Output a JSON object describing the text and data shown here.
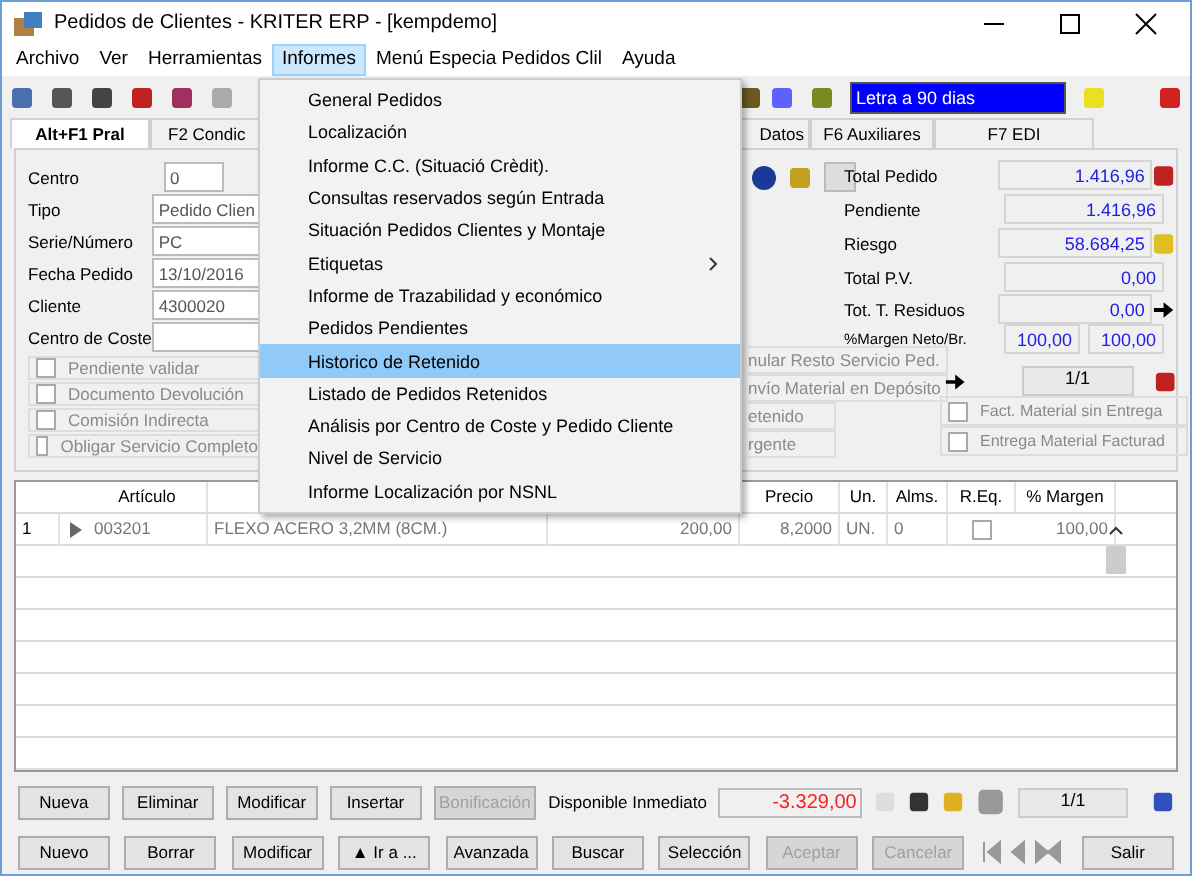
{
  "window": {
    "title": "Pedidos de Clientes - KRITER ERP - [kempdemo]"
  },
  "menu_bar": [
    {
      "label": "Archivo",
      "selected": false
    },
    {
      "label": "Ver",
      "selected": false
    },
    {
      "label": "Herramientas",
      "selected": false
    },
    {
      "label": "Informes",
      "selected": true
    },
    {
      "label": "Menú Especia Pedidos Clil",
      "selected": false
    },
    {
      "label": "Ayuda",
      "selected": false
    }
  ],
  "dropdown": [
    {
      "label": "General Pedidos",
      "selected": false,
      "submenu": false
    },
    {
      "label": "Localización",
      "selected": false,
      "submenu": false
    },
    {
      "label": "Informe C.C. (Situació Crèdit).",
      "selected": false,
      "submenu": false
    },
    {
      "label": "Consultas reservados según Entrada",
      "selected": false,
      "submenu": false
    },
    {
      "label": "Situación Pedidos Clientes y Montaje",
      "selected": false,
      "submenu": false
    },
    {
      "label": "Etiquetas",
      "selected": false,
      "submenu": true
    },
    {
      "label": "Informe de Trazabilidad y económico",
      "selected": false,
      "submenu": false
    },
    {
      "label": "Pedidos Pendientes",
      "selected": false,
      "submenu": false
    },
    {
      "label": "Historico de Retenido",
      "selected": true,
      "submenu": false
    },
    {
      "label": "Listado de Pedidos Retenidos",
      "selected": false,
      "submenu": false
    },
    {
      "label": "Análisis por Centro de Coste y Pedido Cliente",
      "selected": false,
      "submenu": false
    },
    {
      "label": "Nivel de Servicio",
      "selected": false,
      "submenu": false
    },
    {
      "label": "Informe Localización por NSNL",
      "selected": false,
      "submenu": false
    }
  ],
  "payment_field": "Letra a 90 dias",
  "tabs": [
    {
      "label": "Alt+F1 Pral",
      "selected": true
    },
    {
      "label": "F2 Condic",
      "selected": false
    },
    {
      "label": "Datos",
      "selected": false
    },
    {
      "label": "F6 Auxiliares",
      "selected": false
    },
    {
      "label": "F7 EDI",
      "selected": false
    }
  ],
  "form": [
    {
      "label": "Centro",
      "value": "0"
    },
    {
      "label": "Tipo",
      "value": "Pedido Clien"
    },
    {
      "label": "Serie/Número",
      "value": "PC"
    },
    {
      "label": "Fecha Pedido",
      "value": "13/10/2016"
    },
    {
      "label": "Cliente",
      "value": "4300020"
    },
    {
      "label": "Centro de Coste"
    }
  ],
  "left_checks": [
    {
      "label": "Pendiente validar",
      "checked": false
    },
    {
      "label": "Documento Devolución",
      "checked": false
    },
    {
      "label": "Comisión Indirecta",
      "checked": false
    },
    {
      "label": "Obligar Servicio Completo",
      "checked": false
    }
  ],
  "middle_items": [
    "nular Resto Servicio Ped.",
    "nvío Material en Depósito",
    "etenido",
    "rgente"
  ],
  "totals": [
    {
      "label": "Total Pedido",
      "value": "1.416,96"
    },
    {
      "label": "Pendiente",
      "value": "1.416,96"
    },
    {
      "label": "Riesgo",
      "value": "58.684,25"
    },
    {
      "label": "Total P.V.",
      "value": "0,00"
    },
    {
      "label": "Tot. T. Residuos",
      "value": "0,00"
    }
  ],
  "margin": {
    "label": "%Margen Neto/Br.",
    "neto": "100,00",
    "bruto": "100,00"
  },
  "pager_top": "1/1",
  "right_checks": [
    {
      "label": "Fact. Material sin Entrega",
      "checked": false
    },
    {
      "label": "Entrega Material Facturad",
      "checked": false
    }
  ],
  "table": {
    "columns": [
      "Artículo",
      "Precio",
      "Un.",
      "Alms.",
      "R.Eq.",
      "% Margen"
    ],
    "rows": [
      {
        "index": "1",
        "articulo": "003201",
        "descripcion": "FLEXO ACERO 3,2MM (8CM.)",
        "cantidad": "200,00",
        "precio": "8,2000",
        "un": "UN.",
        "alms": "0",
        "req": false,
        "margen": "100,00"
      }
    ]
  },
  "line_buttons": [
    {
      "label": "Nueva",
      "disabled": false
    },
    {
      "label": "Eliminar",
      "disabled": false
    },
    {
      "label": "Modificar",
      "disabled": false
    },
    {
      "label": "Insertar",
      "disabled": false
    },
    {
      "label": "Bonificación",
      "disabled": true
    }
  ],
  "disponible": {
    "label": "Disponible Inmediato",
    "value": "-3.329,00"
  },
  "pager_bottom": "1/1",
  "main_buttons": [
    {
      "label": "Nuevo",
      "disabled": false
    },
    {
      "label": "Borrar",
      "disabled": false
    },
    {
      "label": "Modificar",
      "disabled": false
    },
    {
      "label": "▲ Ir a ...",
      "disabled": false
    },
    {
      "label": "Avanzada",
      "disabled": false
    },
    {
      "label": "Buscar",
      "disabled": false
    },
    {
      "label": "Selección",
      "disabled": false
    },
    {
      "label": "Aceptar",
      "disabled": true
    },
    {
      "label": "Cancelar",
      "disabled": true
    }
  ],
  "exit_button": "Salir"
}
